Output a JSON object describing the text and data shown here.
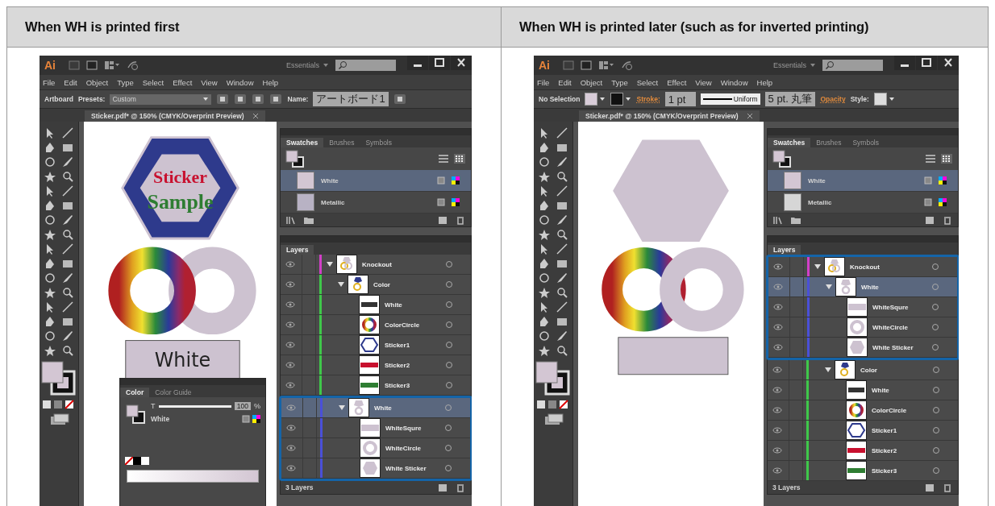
{
  "columns": [
    {
      "heading": "When WH is printed first",
      "screen": {
        "title_bar": {
          "logo": "Ai",
          "workspace": "Essentials"
        },
        "menu": [
          "File",
          "Edit",
          "Object",
          "Type",
          "Select",
          "Effect",
          "View",
          "Window",
          "Help"
        ],
        "control_bar": [
          {
            "kind": "label",
            "text": "Artboard",
            "accent": false
          },
          {
            "kind": "label",
            "text": "Presets:",
            "accent": false
          },
          {
            "kind": "dropdown",
            "value": "Custom"
          },
          {
            "kind": "icon"
          },
          {
            "kind": "icon"
          },
          {
            "kind": "icon"
          },
          {
            "kind": "icon"
          },
          {
            "kind": "label",
            "text": "Name:",
            "accent": false
          },
          {
            "kind": "field",
            "value": "アートボード1"
          },
          {
            "kind": "icon"
          }
        ],
        "document_tab": "Sticker.pdf* @ 150% (CMYK/Overprint Preview)",
        "artwork": {
          "kind": "sticker",
          "sticker_text": [
            "Sticker",
            "Sample"
          ],
          "label_box_text": "White"
        },
        "color_panel": {
          "tabs": [
            {
              "label": "Color",
              "selected": true
            },
            {
              "label": "Color Guide",
              "selected": false
            }
          ],
          "channel": "T",
          "level": 1,
          "value": "100",
          "unit": "%",
          "swatch_name": "White"
        },
        "swatches": {
          "tabs": [
            {
              "label": "Swatches",
              "selected": true
            },
            {
              "label": "Brushes",
              "selected": false
            },
            {
              "label": "Symbols",
              "selected": false
            }
          ],
          "items": [
            {
              "name": "White",
              "selected": true,
              "color": "#d3c6d3"
            },
            {
              "name": "Metallic",
              "selected": false,
              "color": "#b8b2c4"
            }
          ]
        },
        "layers": {
          "title": "Layers",
          "footer": "3 Layers",
          "items": [
            {
              "name": "Knockout",
              "kind": "mixed",
              "color": "#d23fc8",
              "expanded": true,
              "selected": false,
              "highlighted": false,
              "children": [
                {
                  "name": "Color",
                  "kind": "color-group",
                  "color": "#3fc84a",
                  "expanded": true,
                  "selected": false,
                  "highlighted": false,
                  "children": [
                    {
                      "name": "White",
                      "kind": "text-box",
                      "selected": false,
                      "highlighted": false
                    },
                    {
                      "name": "ColorCircle",
                      "kind": "color-ring",
                      "selected": false,
                      "highlighted": false
                    },
                    {
                      "name": "Sticker1",
                      "kind": "hexagon-outline",
                      "selected": false,
                      "highlighted": false
                    },
                    {
                      "name": "Sticker2",
                      "kind": "red-text",
                      "selected": false,
                      "highlighted": false
                    },
                    {
                      "name": "Sticker3",
                      "kind": "green-text",
                      "selected": false,
                      "highlighted": false
                    }
                  ]
                },
                {
                  "name": "White",
                  "kind": "white-group",
                  "color": "#4a50d8",
                  "expanded": true,
                  "selected": true,
                  "highlighted": true,
                  "children": [
                    {
                      "name": "WhiteSqure",
                      "kind": "white-square",
                      "selected": false,
                      "highlighted": true
                    },
                    {
                      "name": "WhiteCircle",
                      "kind": "white-ring",
                      "selected": false,
                      "highlighted": true
                    },
                    {
                      "name": "White Sticker",
                      "kind": "white-hexagon",
                      "selected": false,
                      "highlighted": true
                    }
                  ]
                }
              ]
            }
          ]
        }
      }
    },
    {
      "heading": "When WH is printed later (such as for inverted printing)",
      "screen": {
        "title_bar": {
          "logo": "Ai",
          "workspace": "Essentials"
        },
        "menu": [
          "File",
          "Edit",
          "Object",
          "Type",
          "Select",
          "Effect",
          "View",
          "Window",
          "Help"
        ],
        "control_bar": [
          {
            "kind": "label",
            "text": "No Selection",
            "accent": false
          },
          {
            "kind": "swatch",
            "color": "#d8ccd8"
          },
          {
            "kind": "swatch",
            "color": "#111111"
          },
          {
            "kind": "label",
            "text": "Stroke:",
            "accent": true
          },
          {
            "kind": "field",
            "value": "1 pt"
          },
          {
            "kind": "profile",
            "value": "Uniform"
          },
          {
            "kind": "field",
            "value": "5 pt. 丸筆"
          },
          {
            "kind": "label",
            "text": "Opacity",
            "accent": true
          },
          {
            "kind": "label",
            "text": "Style:",
            "accent": false
          },
          {
            "kind": "swatch",
            "color": "#dddddd"
          }
        ],
        "document_tab": "Sticker.pdf* @ 150% (CMYK/Overprint Preview)",
        "artwork": {
          "kind": "plain"
        },
        "swatches": {
          "tabs": [
            {
              "label": "Swatches",
              "selected": true
            },
            {
              "label": "Brushes",
              "selected": false
            },
            {
              "label": "Symbols",
              "selected": false
            }
          ],
          "items": [
            {
              "name": "White",
              "selected": true,
              "color": "#d3c6d3"
            },
            {
              "name": "Metallic",
              "selected": false,
              "color": "#d6d6d6"
            }
          ]
        },
        "layers": {
          "title": "Layers",
          "footer": "3 Layers",
          "items": [
            {
              "name": "Knockout",
              "kind": "mixed",
              "color": "#d23fc8",
              "expanded": true,
              "selected": false,
              "highlighted": true,
              "children": [
                {
                  "name": "White",
                  "kind": "white-group",
                  "color": "#4a50d8",
                  "expanded": true,
                  "selected": true,
                  "highlighted": true,
                  "children": [
                    {
                      "name": "WhiteSqure",
                      "kind": "white-square",
                      "selected": false,
                      "highlighted": true
                    },
                    {
                      "name": "WhiteCircle",
                      "kind": "white-ring",
                      "selected": false,
                      "highlighted": true
                    },
                    {
                      "name": "White Sticker",
                      "kind": "white-hexagon",
                      "selected": false,
                      "highlighted": true
                    }
                  ]
                },
                {
                  "name": "Color",
                  "kind": "color-group",
                  "color": "#3fc84a",
                  "expanded": true,
                  "selected": false,
                  "highlighted": false,
                  "children": [
                    {
                      "name": "White",
                      "kind": "text-box",
                      "selected": false,
                      "highlighted": false
                    },
                    {
                      "name": "ColorCircle",
                      "kind": "color-ring",
                      "selected": false,
                      "highlighted": false
                    },
                    {
                      "name": "Sticker1",
                      "kind": "hexagon-outline",
                      "selected": false,
                      "highlighted": false
                    },
                    {
                      "name": "Sticker2",
                      "kind": "red-text",
                      "selected": false,
                      "highlighted": false
                    },
                    {
                      "name": "Sticker3",
                      "kind": "green-text",
                      "selected": false,
                      "highlighted": false
                    }
                  ]
                }
              ]
            }
          ]
        }
      }
    }
  ]
}
